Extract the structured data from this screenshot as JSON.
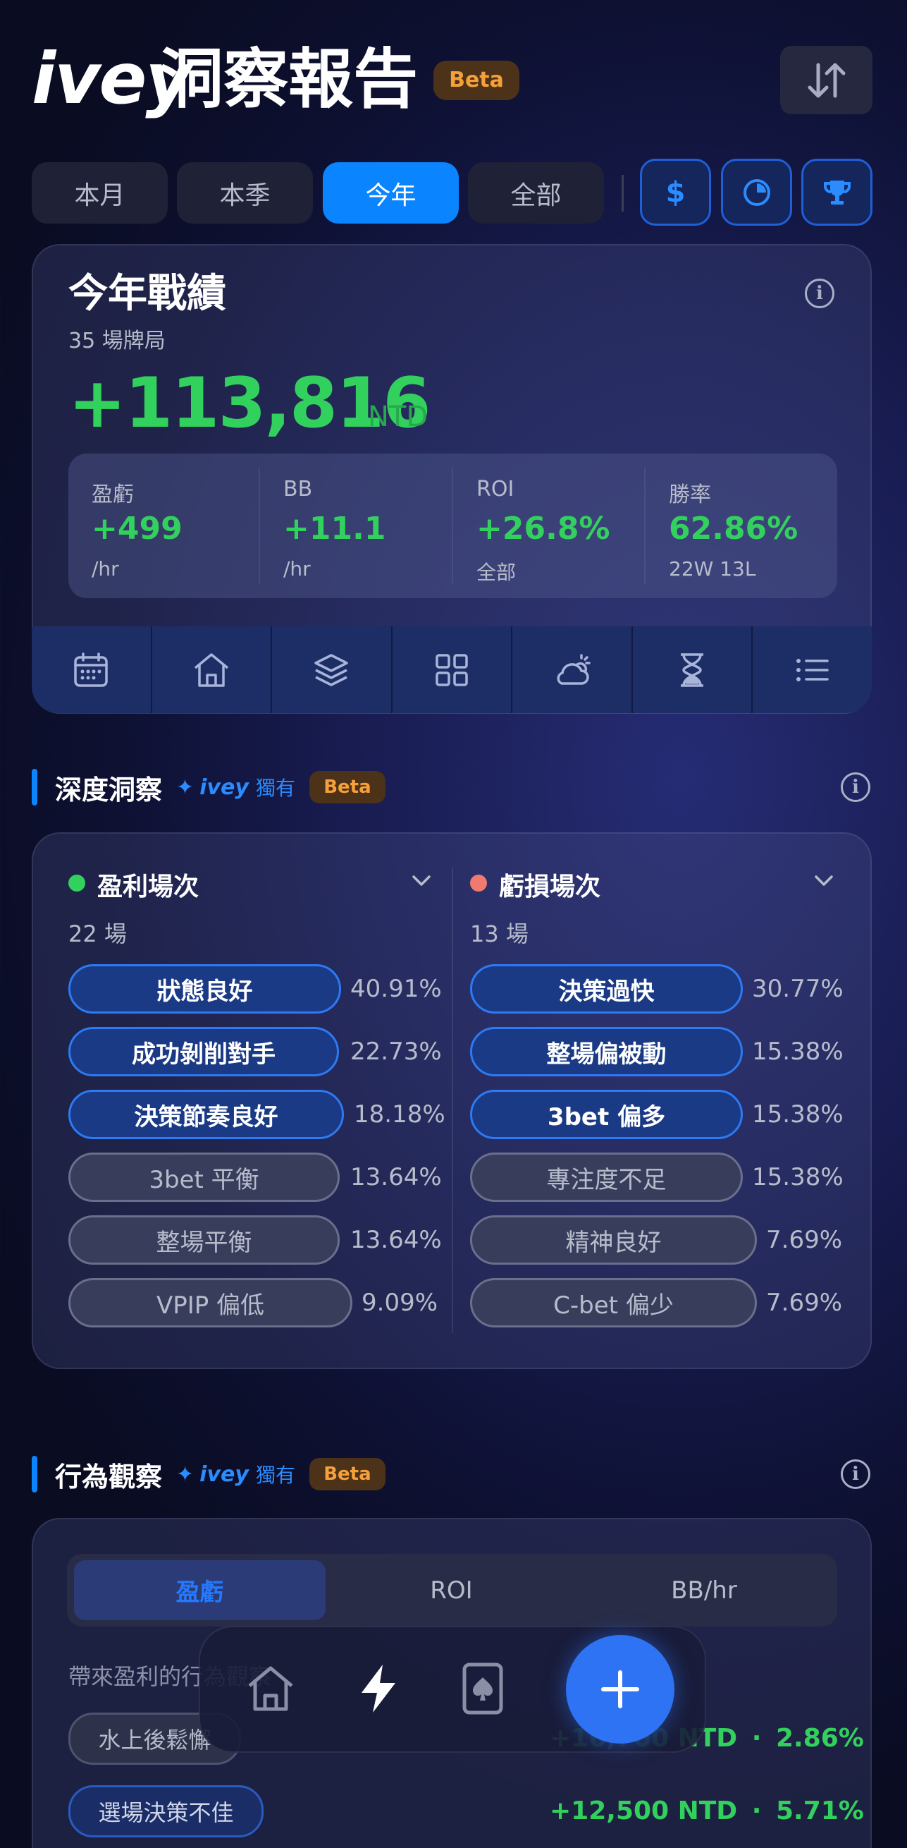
{
  "header": {
    "brand": "ivey",
    "title": "洞察報告",
    "beta": "Beta"
  },
  "period_tabs": [
    {
      "label": "本月"
    },
    {
      "label": "本季"
    },
    {
      "label": "今年",
      "active": true
    },
    {
      "label": "全部"
    }
  ],
  "summary": {
    "title": "今年戰績",
    "sessions": "35 場牌局",
    "total": "+113,816",
    "currency": "NTD",
    "stats": [
      {
        "label": "盈虧",
        "value": "+499",
        "unit": "/hr"
      },
      {
        "label": "BB",
        "value": "+11.1",
        "unit": "/hr"
      },
      {
        "label": "ROI",
        "value": "+26.8%",
        "unit": "全部"
      },
      {
        "label": "勝率",
        "value": "62.86%",
        "unit": "22W 13L"
      }
    ]
  },
  "deep_insight": {
    "title": "深度洞察",
    "exclusive_brand": "ivey",
    "exclusive_label": "獨有",
    "beta": "Beta",
    "win": {
      "title": "盈利場次",
      "count": "22 場",
      "items": [
        {
          "label": "狀態良好",
          "pct": "40.91%"
        },
        {
          "label": "成功剝削對手",
          "pct": "22.73%"
        },
        {
          "label": "決策節奏良好",
          "pct": "18.18%"
        },
        {
          "label": "3bet 平衡",
          "pct": "13.64%"
        },
        {
          "label": "整場平衡",
          "pct": "13.64%"
        },
        {
          "label": "VPIP 偏低",
          "pct": "9.09%"
        }
      ]
    },
    "loss": {
      "title": "虧損場次",
      "count": "13 場",
      "items": [
        {
          "label": "決策過快",
          "pct": "30.77%"
        },
        {
          "label": "整場偏被動",
          "pct": "15.38%"
        },
        {
          "label": "3bet 偏多",
          "pct": "15.38%"
        },
        {
          "label": "專注度不足",
          "pct": "15.38%"
        },
        {
          "label": "精神良好",
          "pct": "7.69%"
        },
        {
          "label": "C-bet 偏少",
          "pct": "7.69%"
        }
      ]
    }
  },
  "behavior": {
    "title": "行為觀察",
    "exclusive_brand": "ivey",
    "exclusive_label": "獨有",
    "beta": "Beta",
    "segments": [
      {
        "label": "盈虧",
        "active": true
      },
      {
        "label": "ROI"
      },
      {
        "label": "BB/hr"
      }
    ],
    "subtitle": "帶來盈利的行為觀察",
    "rows": [
      {
        "tag": "水上後鬆懈",
        "amount": "+16,700 NTD",
        "pct": "2.86%"
      },
      {
        "tag": "選場決策不佳",
        "amount": "+12,500 NTD",
        "pct": "5.71%"
      }
    ],
    "sep": "·"
  },
  "colors": {
    "accent": "#0a84ff",
    "positive": "#32d15d",
    "beta": "#f5a03a"
  }
}
